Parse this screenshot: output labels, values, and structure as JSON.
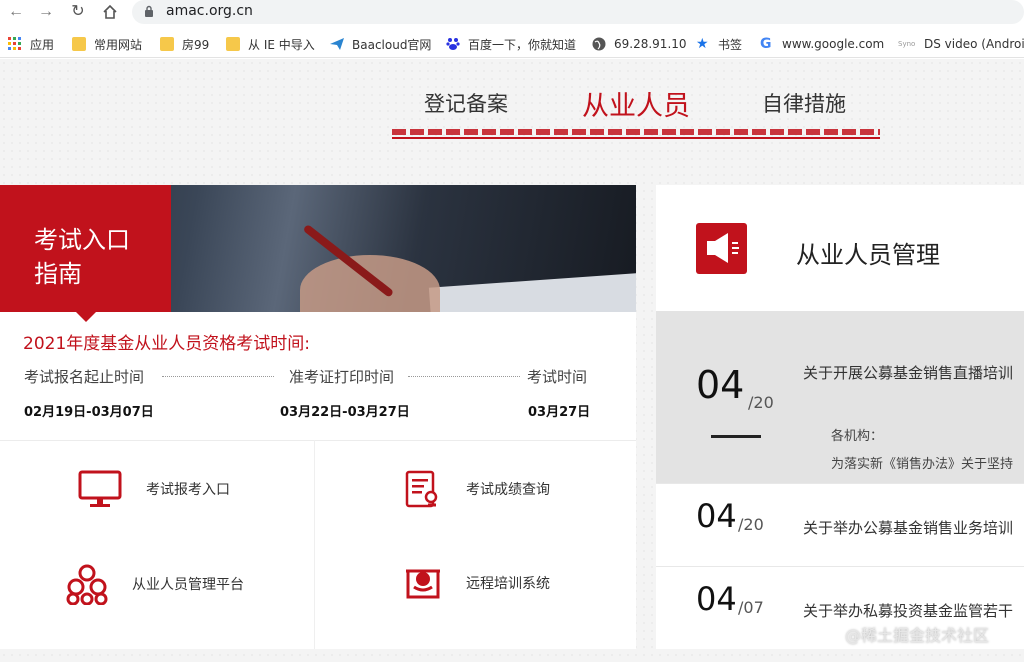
{
  "browser": {
    "url": "amac.org.cn",
    "bookmarks": [
      {
        "label": "应用",
        "icon": "apps-grid-icon"
      },
      {
        "label": "常用网站",
        "icon": "folder-icon"
      },
      {
        "label": "房99",
        "icon": "folder-icon"
      },
      {
        "label": "从 IE 中导入",
        "icon": "folder-icon"
      },
      {
        "label": "Baacloud官网",
        "icon": "paper-plane-icon"
      },
      {
        "label": "百度一下，你就知道",
        "icon": "baidu-paw-icon"
      },
      {
        "label": "69.28.91.10",
        "icon": "globe-icon"
      },
      {
        "label": "书签",
        "icon": "star-icon"
      },
      {
        "label": "www.google.com",
        "icon": "google-g-icon"
      },
      {
        "label": "DS video (Androi...",
        "icon": "synology-icon",
        "badge": "Syno"
      }
    ]
  },
  "nav": {
    "items": [
      "登记备案",
      "从业人员",
      "自律措施"
    ],
    "active": "从业人员",
    "accent": "#c1121c"
  },
  "exam": {
    "banner_line1": "考试入口",
    "banner_line2": "指南",
    "title": "2021年度基金从业人员资格考试时间:",
    "columns": [
      {
        "label": "考试报名起止时间",
        "date": "02月19日-03月07日"
      },
      {
        "label": "准考证打印时间",
        "date": "03月22日-03月27日"
      },
      {
        "label": "考试时间",
        "date": "03月27日"
      }
    ],
    "entries": [
      {
        "label": "考试报考入口",
        "icon": "monitor-icon"
      },
      {
        "label": "考试成绩查询",
        "icon": "document-search-icon"
      },
      {
        "label": "从业人员管理平台",
        "icon": "people-group-icon"
      },
      {
        "label": "远程培训系统",
        "icon": "remote-training-icon"
      }
    ]
  },
  "news": {
    "title": "从业人员管理",
    "icon": "megaphone-icon",
    "items": [
      {
        "day": "04",
        "month": "/20",
        "title": "关于开展公募基金销售直播培训",
        "sub1": "各机构：",
        "sub2": "为落实新《销售办法》关于坚持"
      },
      {
        "day": "04",
        "month": "/20",
        "title": "关于举办公募基金销售业务培训"
      },
      {
        "day": "04",
        "month": "/07",
        "title": "关于举办私募投资基金监管若干"
      }
    ]
  },
  "watermark": "@稀土掘金技术社区"
}
